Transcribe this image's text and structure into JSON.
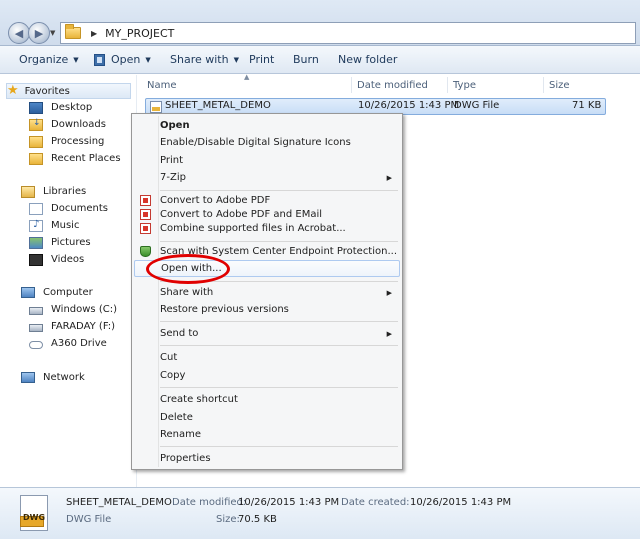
{
  "address_bar": {
    "breadcrumb": "MY_PROJECT"
  },
  "toolbar": {
    "organize": "Organize",
    "open": "Open",
    "share_with": "Share with",
    "print": "Print",
    "burn": "Burn",
    "new_folder": "New folder"
  },
  "nav": {
    "favorites": "Favorites",
    "desktop": "Desktop",
    "downloads": "Downloads",
    "processing": "Processing",
    "recent_places": "Recent Places",
    "libraries": "Libraries",
    "documents": "Documents",
    "music": "Music",
    "pictures": "Pictures",
    "videos": "Videos",
    "computer": "Computer",
    "windows_c": "Windows (C:)",
    "faraday_f": "FARADAY (F:)",
    "a360": "A360 Drive",
    "network": "Network"
  },
  "columns": {
    "name": "Name",
    "date_modified": "Date modified",
    "type": "Type",
    "size": "Size"
  },
  "file": {
    "name": "SHEET_METAL_DEMO",
    "date": "10/26/2015 1:43 PM",
    "type": "DWG File",
    "size": "71 KB"
  },
  "context_menu": {
    "open": "Open",
    "enable_disable_sig": "Enable/Disable Digital Signature Icons",
    "print": "Print",
    "seven_zip": "7-Zip",
    "convert_pdf": "Convert to Adobe PDF",
    "convert_pdf_email": "Convert to Adobe PDF and EMail",
    "combine_acrobat": "Combine supported files in Acrobat...",
    "scan_endpoint": "Scan with System Center Endpoint Protection...",
    "open_with": "Open with...",
    "share_with": "Share with",
    "restore_versions": "Restore previous versions",
    "send_to": "Send to",
    "cut": "Cut",
    "copy": "Copy",
    "create_shortcut": "Create shortcut",
    "delete": "Delete",
    "rename": "Rename",
    "properties": "Properties"
  },
  "details": {
    "icon_text": "DWG",
    "name": "SHEET_METAL_DEMO",
    "type": "DWG File",
    "date_modified_label": "Date modified:",
    "date_modified": "10/26/2015 1:43 PM",
    "date_created_label": "Date created:",
    "date_created": "10/26/2015 1:43 PM",
    "size_label": "Size:",
    "size": "70.5 KB"
  },
  "colors": {
    "highlight_circle": "#e00000",
    "selection": "#c8ddf6"
  }
}
